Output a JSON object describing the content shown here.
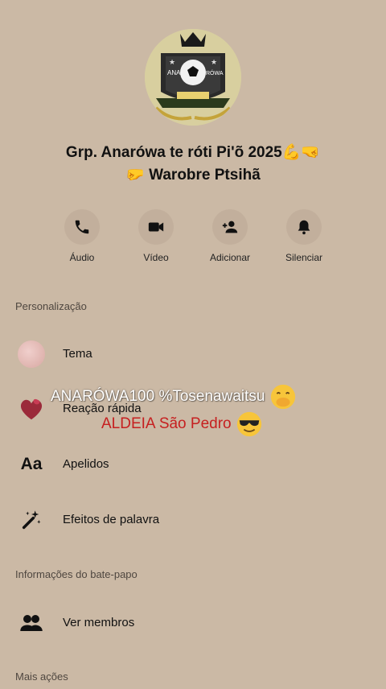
{
  "group": {
    "title_line1": "Grp. Anarówa te róti  Pi'õ 2025💪🤜",
    "title_line2": "🤛 Warobre Ptsihã"
  },
  "actions": [
    {
      "label": "Áudio",
      "icon": "phone-icon"
    },
    {
      "label": "Vídeo",
      "icon": "video-icon"
    },
    {
      "label": "Adicionar",
      "icon": "add-person-icon"
    },
    {
      "label": "Silenciar",
      "icon": "bell-icon"
    }
  ],
  "sections": {
    "personalization": "Personalização",
    "chat_info": "Informações do bate-papo",
    "more_actions": "Mais ações"
  },
  "rows": {
    "theme": "Tema",
    "quick_reaction": "Reação rápida",
    "nicknames": "Apelidos",
    "word_effects": "Efeitos de palavra",
    "view_members": "Ver membros"
  },
  "overlay": {
    "line1": "ANARÓWA100 %Tosenawaitsu",
    "line2": "ALDEIA São Pedro"
  },
  "avatar_text": {
    "left": "ANA",
    "right": "RÓWA"
  },
  "colors": {
    "background": "#cbb9a5",
    "overlay_red": "#c62020"
  }
}
